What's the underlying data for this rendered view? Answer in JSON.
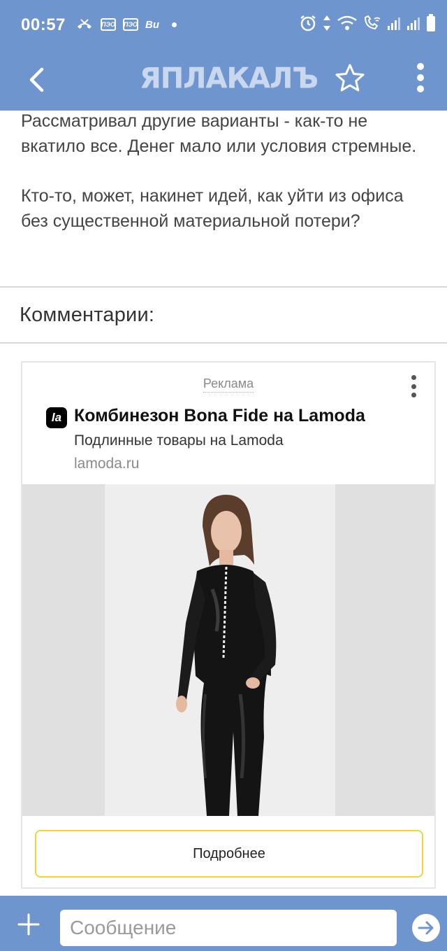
{
  "status_bar": {
    "time": "00:57",
    "mini_badges": [
      "ПЭО",
      "ПЭО"
    ],
    "carrier_short": "Ви"
  },
  "app_bar": {
    "logo_text": "ЯПЛАКАЛЪ"
  },
  "post": {
    "paragraph_1": "Рассматривал другие варианты - как-то не вкатило все. Денег мало или условия стремные.",
    "paragraph_2": "Кто-то, может, накинет идей, как уйти из офиса без существенной материальной потери?"
  },
  "comments": {
    "title": "Комментарии:"
  },
  "ad": {
    "label": "Реклама",
    "logo_text": "la",
    "title": "Комбинезон Bona Fide на Lamoda",
    "subtitle": "Подлинные товары на Lamoda",
    "domain": "lamoda.ru",
    "button_label": "Подробнее"
  },
  "composer": {
    "placeholder": "Сообщение"
  },
  "colors": {
    "accent": "#6f95cf",
    "ad_button_border": "#f2d33a"
  }
}
